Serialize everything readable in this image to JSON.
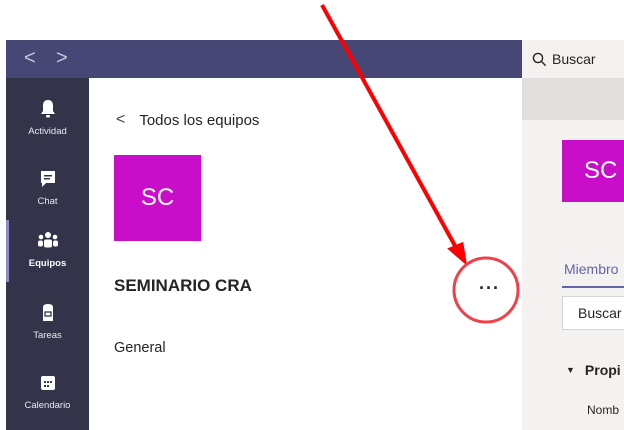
{
  "topbar": {
    "back_arrow": "<",
    "forward_arrow": ">"
  },
  "search": {
    "placeholder": "Buscar"
  },
  "rail": {
    "items": [
      {
        "label": "Actividad",
        "icon": "bell-icon"
      },
      {
        "label": "Chat",
        "icon": "chat-icon"
      },
      {
        "label": "Equipos",
        "icon": "teams-icon"
      },
      {
        "label": "Tareas",
        "icon": "assignments-icon"
      },
      {
        "label": "Calendario",
        "icon": "calendar-icon"
      }
    ],
    "active": "Equipos"
  },
  "panel": {
    "back_label": "Todos los equipos",
    "avatar_initials": "SC",
    "team_name": "SEMINARIO CRA",
    "more_label": "···",
    "channel": "General"
  },
  "right": {
    "avatar_initials": "SC",
    "members_tab": "Miembro",
    "search_text": "Buscar",
    "properties": "Propi",
    "name_label": "Nomb"
  },
  "colors": {
    "topbar": "#464775",
    "rail": "#33344a",
    "avatar": "#c90ec9",
    "accent": "#6264a7",
    "annotation": "#ff0000"
  }
}
